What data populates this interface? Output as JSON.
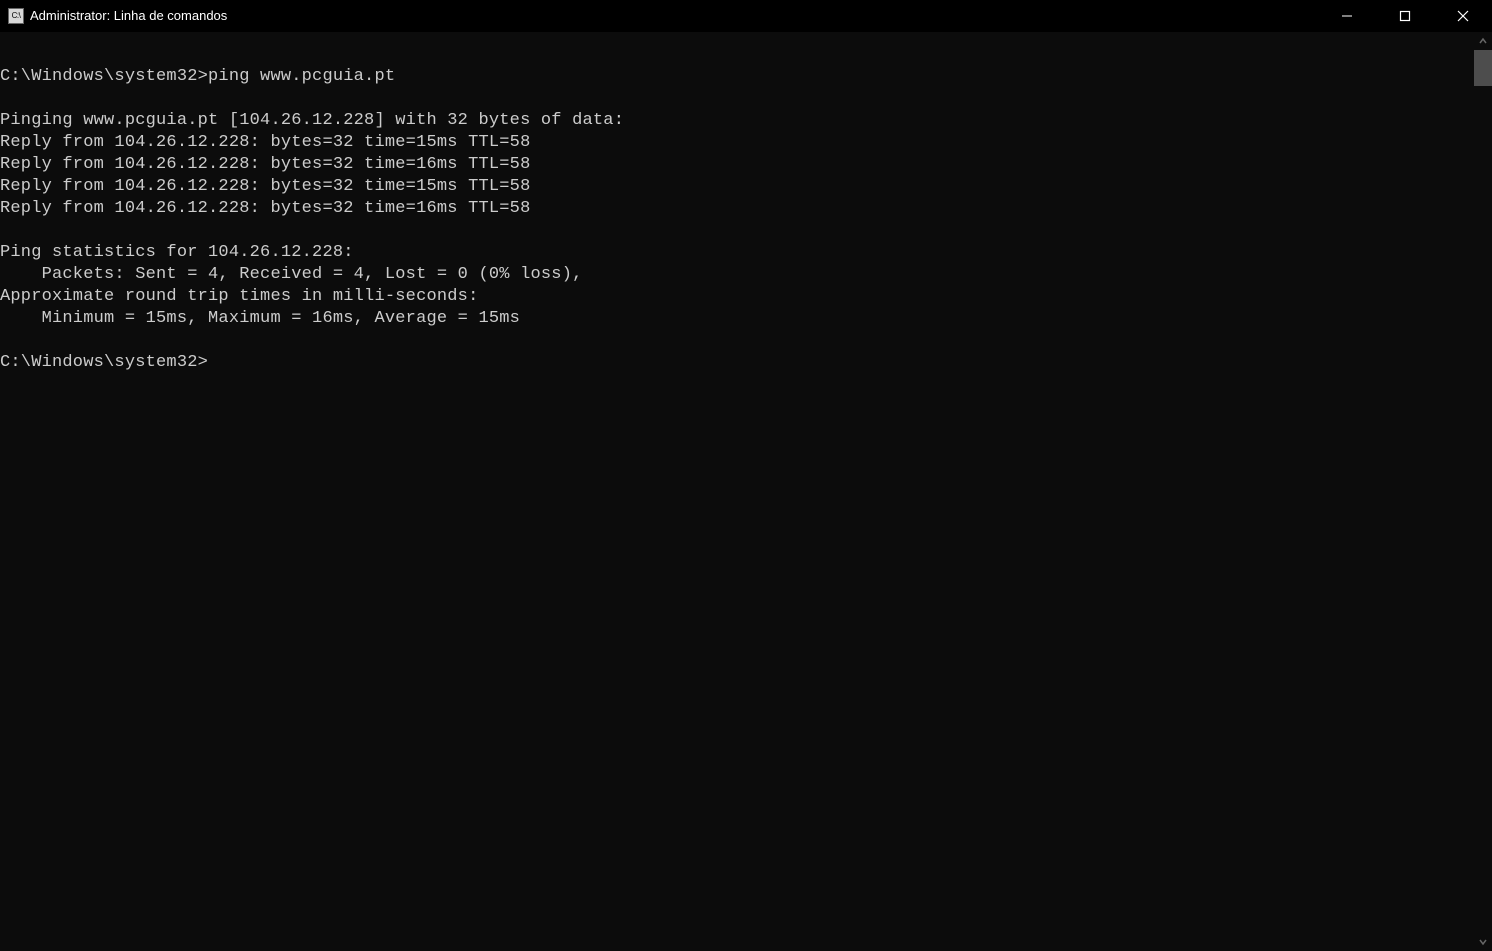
{
  "window": {
    "icon_label": "C:\\",
    "title": "Administrator: Linha de comandos"
  },
  "terminal": {
    "lines": [
      "",
      "C:\\Windows\\system32>ping www.pcguia.pt",
      "",
      "Pinging www.pcguia.pt [104.26.12.228] with 32 bytes of data:",
      "Reply from 104.26.12.228: bytes=32 time=15ms TTL=58",
      "Reply from 104.26.12.228: bytes=32 time=16ms TTL=58",
      "Reply from 104.26.12.228: bytes=32 time=15ms TTL=58",
      "Reply from 104.26.12.228: bytes=32 time=16ms TTL=58",
      "",
      "Ping statistics for 104.26.12.228:",
      "    Packets: Sent = 4, Received = 4, Lost = 0 (0% loss),",
      "Approximate round trip times in milli-seconds:",
      "    Minimum = 15ms, Maximum = 16ms, Average = 15ms",
      "",
      "C:\\Windows\\system32>"
    ]
  }
}
